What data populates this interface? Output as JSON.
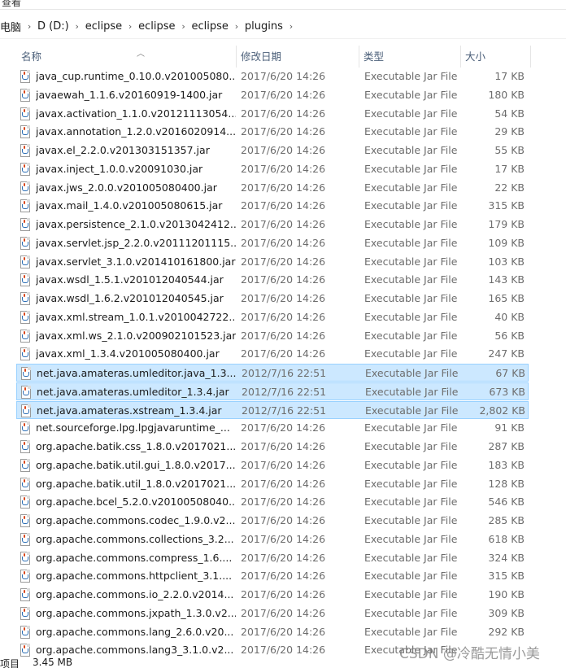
{
  "window": {
    "top_fragment": "查看"
  },
  "address": {
    "crumbs": [
      "电脑",
      "D (D:)",
      "eclipse",
      "eclipse",
      "eclipse",
      "plugins"
    ]
  },
  "columns": {
    "name": "名称",
    "date": "修改日期",
    "type": "类型",
    "size": "大小"
  },
  "files": [
    {
      "name": "java_cup.runtime_0.10.0.v201005080...",
      "date": "2017/6/20 14:26",
      "type": "Executable Jar File",
      "size": "17 KB",
      "selected": false
    },
    {
      "name": "javaewah_1.1.6.v20160919-1400.jar",
      "date": "2017/6/20 14:26",
      "type": "Executable Jar File",
      "size": "180 KB",
      "selected": false
    },
    {
      "name": "javax.activation_1.1.0.v20121113054...",
      "date": "2017/6/20 14:26",
      "type": "Executable Jar File",
      "size": "54 KB",
      "selected": false
    },
    {
      "name": "javax.annotation_1.2.0.v2016020914...",
      "date": "2017/6/20 14:26",
      "type": "Executable Jar File",
      "size": "29 KB",
      "selected": false
    },
    {
      "name": "javax.el_2.2.0.v201303151357.jar",
      "date": "2017/6/20 14:26",
      "type": "Executable Jar File",
      "size": "55 KB",
      "selected": false
    },
    {
      "name": "javax.inject_1.0.0.v20091030.jar",
      "date": "2017/6/20 14:26",
      "type": "Executable Jar File",
      "size": "17 KB",
      "selected": false
    },
    {
      "name": "javax.jws_2.0.0.v201005080400.jar",
      "date": "2017/6/20 14:26",
      "type": "Executable Jar File",
      "size": "22 KB",
      "selected": false
    },
    {
      "name": "javax.mail_1.4.0.v201005080615.jar",
      "date": "2017/6/20 14:26",
      "type": "Executable Jar File",
      "size": "315 KB",
      "selected": false
    },
    {
      "name": "javax.persistence_2.1.0.v2013042412...",
      "date": "2017/6/20 14:26",
      "type": "Executable Jar File",
      "size": "179 KB",
      "selected": false
    },
    {
      "name": "javax.servlet.jsp_2.2.0.v20111201115...",
      "date": "2017/6/20 14:26",
      "type": "Executable Jar File",
      "size": "109 KB",
      "selected": false
    },
    {
      "name": "javax.servlet_3.1.0.v201410161800.jar",
      "date": "2017/6/20 14:26",
      "type": "Executable Jar File",
      "size": "103 KB",
      "selected": false
    },
    {
      "name": "javax.wsdl_1.5.1.v201012040544.jar",
      "date": "2017/6/20 14:26",
      "type": "Executable Jar File",
      "size": "143 KB",
      "selected": false
    },
    {
      "name": "javax.wsdl_1.6.2.v201012040545.jar",
      "date": "2017/6/20 14:26",
      "type": "Executable Jar File",
      "size": "165 KB",
      "selected": false
    },
    {
      "name": "javax.xml.stream_1.0.1.v2010042722...",
      "date": "2017/6/20 14:26",
      "type": "Executable Jar File",
      "size": "40 KB",
      "selected": false
    },
    {
      "name": "javax.xml.ws_2.1.0.v200902101523.jar",
      "date": "2017/6/20 14:26",
      "type": "Executable Jar File",
      "size": "56 KB",
      "selected": false
    },
    {
      "name": "javax.xml_1.3.4.v201005080400.jar",
      "date": "2017/6/20 14:26",
      "type": "Executable Jar File",
      "size": "247 KB",
      "selected": false
    },
    {
      "name": "net.java.amateras.umleditor.java_1.3....",
      "date": "2012/7/16 22:51",
      "type": "Executable Jar File",
      "size": "67 KB",
      "selected": true
    },
    {
      "name": "net.java.amateras.umleditor_1.3.4.jar",
      "date": "2012/7/16 22:51",
      "type": "Executable Jar File",
      "size": "673 KB",
      "selected": true
    },
    {
      "name": "net.java.amateras.xstream_1.3.4.jar",
      "date": "2012/7/16 22:51",
      "type": "Executable Jar File",
      "size": "2,802 KB",
      "selected": true
    },
    {
      "name": "net.sourceforge.lpg.lpgjavaruntime_...",
      "date": "2017/6/20 14:26",
      "type": "Executable Jar File",
      "size": "91 KB",
      "selected": false
    },
    {
      "name": "org.apache.batik.css_1.8.0.v2017021...",
      "date": "2017/6/20 14:26",
      "type": "Executable Jar File",
      "size": "287 KB",
      "selected": false
    },
    {
      "name": "org.apache.batik.util.gui_1.8.0.v2017...",
      "date": "2017/6/20 14:26",
      "type": "Executable Jar File",
      "size": "183 KB",
      "selected": false
    },
    {
      "name": "org.apache.batik.util_1.8.0.v2017021...",
      "date": "2017/6/20 14:26",
      "type": "Executable Jar File",
      "size": "128 KB",
      "selected": false
    },
    {
      "name": "org.apache.bcel_5.2.0.v20100508040...",
      "date": "2017/6/20 14:26",
      "type": "Executable Jar File",
      "size": "546 KB",
      "selected": false
    },
    {
      "name": "org.apache.commons.codec_1.9.0.v2...",
      "date": "2017/6/20 14:26",
      "type": "Executable Jar File",
      "size": "285 KB",
      "selected": false
    },
    {
      "name": "org.apache.commons.collections_3.2...",
      "date": "2017/6/20 14:26",
      "type": "Executable Jar File",
      "size": "618 KB",
      "selected": false
    },
    {
      "name": "org.apache.commons.compress_1.6....",
      "date": "2017/6/20 14:26",
      "type": "Executable Jar File",
      "size": "324 KB",
      "selected": false
    },
    {
      "name": "org.apache.commons.httpclient_3.1....",
      "date": "2017/6/20 14:26",
      "type": "Executable Jar File",
      "size": "315 KB",
      "selected": false
    },
    {
      "name": "org.apache.commons.io_2.2.0.v2014...",
      "date": "2017/6/20 14:26",
      "type": "Executable Jar File",
      "size": "190 KB",
      "selected": false
    },
    {
      "name": "org.apache.commons.jxpath_1.3.0.v2...",
      "date": "2017/6/20 14:26",
      "type": "Executable Jar File",
      "size": "309 KB",
      "selected": false
    },
    {
      "name": "org.apache.commons.lang_2.6.0.v20...",
      "date": "2017/6/20 14:26",
      "type": "Executable Jar File",
      "size": "292 KB",
      "selected": false
    },
    {
      "name": "org.apache.commons.lang3_3.1.0.v2...",
      "date": "2017/6/20 14:26",
      "type": "Executable Jar File",
      "size": "",
      "selected": false
    }
  ],
  "status": {
    "count": "项目",
    "selection_size": "3.45 MB"
  },
  "watermark": "CSDN @冷酷无情小美",
  "colors": {
    "selected_bg": "#cce8ff",
    "selected_border": "#99d1ff",
    "header_text": "#4c607a"
  },
  "icons": {
    "file": "jar-file-icon",
    "separator": "chevron-right-icon",
    "sort": "sort-up-icon"
  }
}
